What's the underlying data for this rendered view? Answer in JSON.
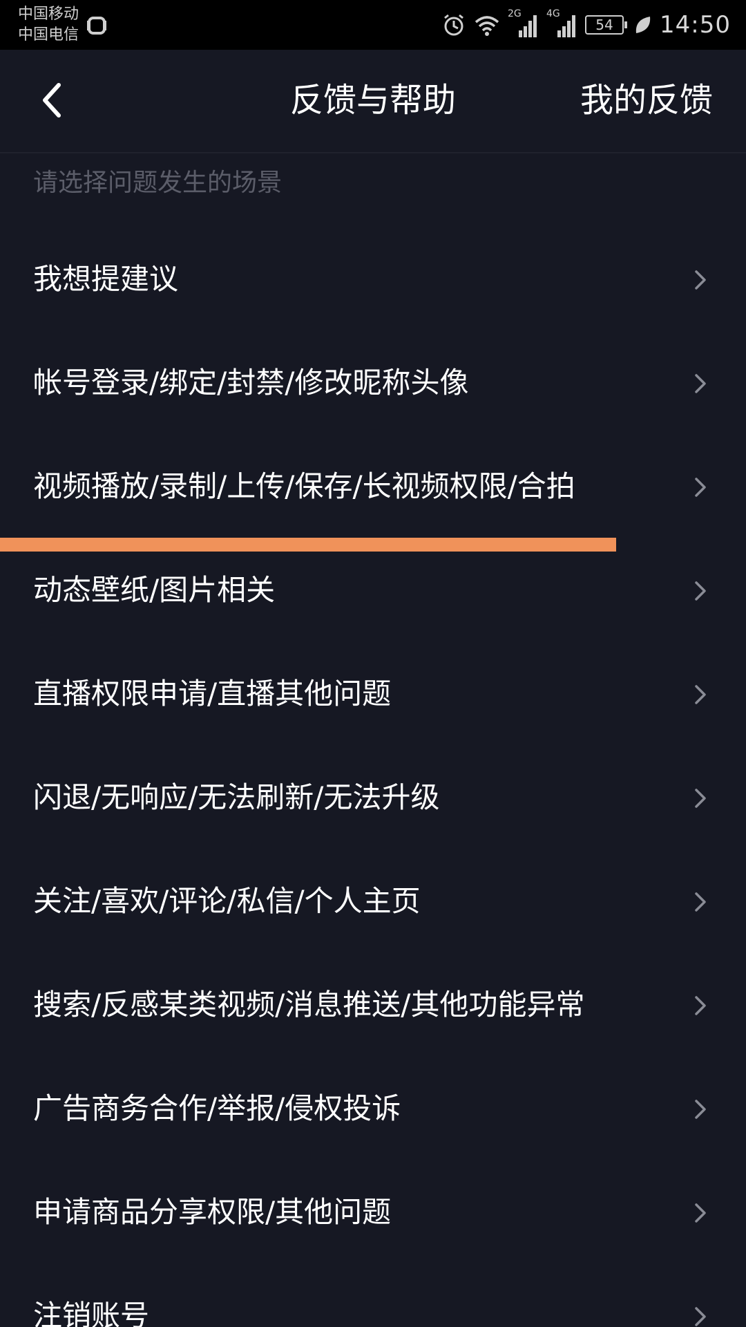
{
  "status_bar": {
    "carrier_1": "中国移动",
    "carrier_2": "中国电信",
    "network_1": "2G",
    "network_2": "4G",
    "battery": "54",
    "time": "14:50",
    "icons": [
      "alarm-icon",
      "wifi-icon",
      "signal-icon",
      "signal-icon",
      "battery-icon",
      "leaf-icon"
    ]
  },
  "header": {
    "back_icon": "chevron-left-icon",
    "title": "反馈与帮助",
    "my_feedback": "我的反馈"
  },
  "section": {
    "hint": "请选择问题发生的场景"
  },
  "items": [
    {
      "label": "我想提建议"
    },
    {
      "label": "帐号登录/绑定/封禁/修改昵称头像"
    },
    {
      "label": "视频播放/录制/上传/保存/长视频权限/合拍"
    },
    {
      "label": "动态壁纸/图片相关"
    },
    {
      "label": "直播权限申请/直播其他问题"
    },
    {
      "label": "闪退/无响应/无法刷新/无法升级"
    },
    {
      "label": "关注/喜欢/评论/私信/个人主页"
    },
    {
      "label": "搜索/反感某类视频/消息推送/其他功能异常"
    },
    {
      "label": "广告商务合作/举报/侵权投诉"
    },
    {
      "label": "申请商品分享权限/其他问题"
    },
    {
      "label": "注销账号"
    }
  ],
  "colors": {
    "background": "#161823",
    "status_bar": "#000000",
    "highlight": "#f0925a",
    "hint_text": "#5b5d69",
    "text": "#ffffff"
  }
}
